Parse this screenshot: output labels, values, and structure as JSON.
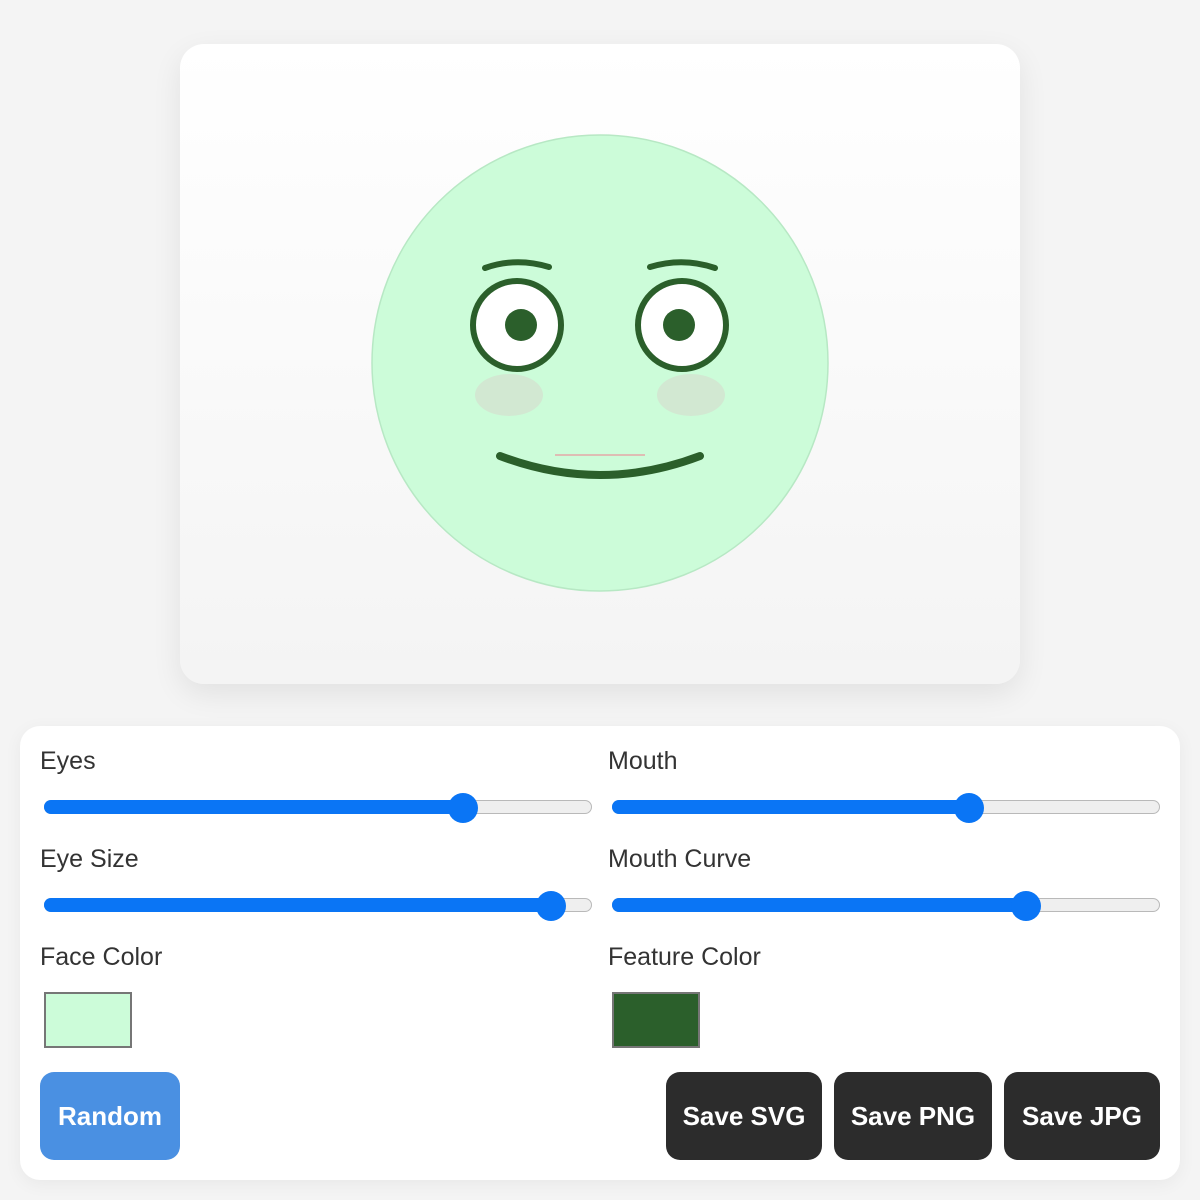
{
  "face": {
    "face_color": "#ccfcd9",
    "feature_color": "#2b5f2b",
    "blush_color": "#d2e8d2"
  },
  "controls": {
    "eyes": {
      "label": "Eyes",
      "value": 0.78
    },
    "mouth": {
      "label": "Mouth",
      "value": 0.66
    },
    "eye_size": {
      "label": "Eye Size",
      "value": 0.95
    },
    "mouth_curve": {
      "label": "Mouth Curve",
      "value": 0.77
    },
    "face_color": {
      "label": "Face Color",
      "value": "#ccfcd9"
    },
    "feature_color": {
      "label": "Feature Color",
      "value": "#2b5f2b"
    }
  },
  "buttons": {
    "random": "Random",
    "save_svg": "Save SVG",
    "save_png": "Save PNG",
    "save_jpg": "Save JPG"
  },
  "colors": {
    "accent": "#0a75f5",
    "random_button": "#4a90e2",
    "dark_button": "#2c2c2c"
  }
}
